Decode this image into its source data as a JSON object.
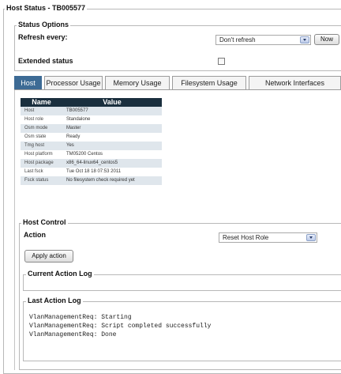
{
  "host_status": {
    "legend": "Host Status - TB005577"
  },
  "status_options": {
    "legend": "Status Options",
    "refresh_label": "Refresh every:",
    "refresh_value": "Don't refresh",
    "now_button": "Now",
    "extended_label": "Extended status",
    "extended_checked": false
  },
  "tabs": [
    {
      "label": "Host",
      "active": true
    },
    {
      "label": "Processor Usage",
      "active": false
    },
    {
      "label": "Memory Usage",
      "active": false
    },
    {
      "label": "Filesystem Usage",
      "active": false
    },
    {
      "label": "Network Interfaces",
      "active": false
    }
  ],
  "info_table": {
    "headers": [
      "Name",
      "Value"
    ],
    "rows": [
      {
        "name": "Host",
        "value": "TB005577"
      },
      {
        "name": "Host role",
        "value": "Standalone"
      },
      {
        "name": "Osm mode",
        "value": "Master"
      },
      {
        "name": "Osm state",
        "value": "Ready"
      },
      {
        "name": "Tmg host",
        "value": "Yes"
      },
      {
        "name": "Host platform",
        "value": "TM05200 Centos"
      },
      {
        "name": "Host package",
        "value": "x86_64-linux64_centos5"
      },
      {
        "name": "Last fsck",
        "value": "Tue Oct 18 18 07:53 2011"
      },
      {
        "name": "Fsck status",
        "value": "No filesystem check required yet"
      }
    ]
  },
  "host_control": {
    "legend": "Host Control",
    "action_label": "Action",
    "action_value": "Reset Host Role",
    "apply_button": "Apply action"
  },
  "current_action_log": {
    "legend": "Current Action Log",
    "lines": []
  },
  "last_action_log": {
    "legend": "Last Action Log",
    "lines": [
      "VlanManagementReq: Starting",
      "VlanManagementReq: Script completed successfully",
      "VlanManagementReq: Done"
    ]
  }
}
